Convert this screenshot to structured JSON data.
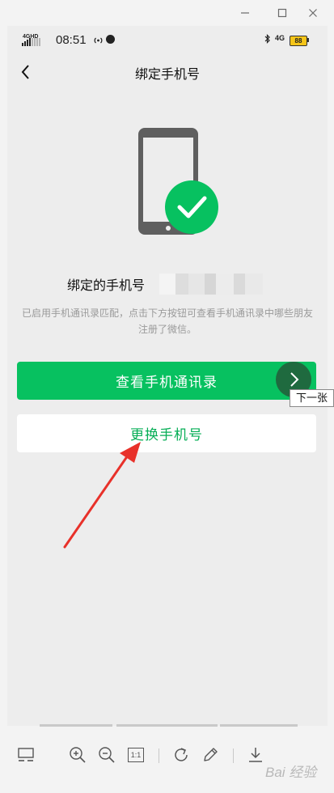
{
  "viewer": {
    "window_controls": {
      "minimize": "—",
      "maximize": "☐",
      "close": "✕"
    },
    "next_tooltip": "下一张",
    "toolbar_items": [
      "thumbnail-view-icon",
      "zoom-in-icon",
      "zoom-out-icon",
      "actual-size-icon",
      "rotate-icon",
      "edit-icon",
      "download-icon"
    ],
    "actual_size_label": "1:1",
    "watermark": "Bai 经验"
  },
  "phone": {
    "status_bar": {
      "network": "4GHD",
      "time": "08:51",
      "data_type": "4G",
      "battery": "88"
    },
    "nav": {
      "title": "绑定手机号"
    },
    "bound_label": "绑定的手机号",
    "description": "已启用手机通讯录匹配，点击下方按钮可查看手机通讯录中哪些朋友注册了微信。",
    "primary_button": "查看手机通讯录",
    "secondary_button": "更换手机号"
  },
  "colors": {
    "wechat_green": "#07c160",
    "secondary_text_green": "#06ae56",
    "page_background": "#ededed",
    "annotation_red": "#e8312a"
  }
}
